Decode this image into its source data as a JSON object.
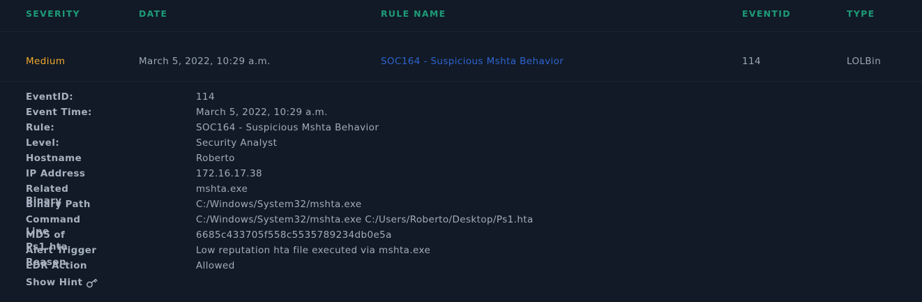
{
  "table": {
    "headers": {
      "severity": "SEVERITY",
      "date": "DATE",
      "rule_name": "RULE NAME",
      "eventid": "EVENTID",
      "type": "TYPE"
    },
    "row": {
      "severity": "Medium",
      "date": "March 5, 2022, 10:29 a.m.",
      "rule_name": "SOC164 - Suspicious Mshta Behavior",
      "eventid": "114",
      "type": "LOLBin"
    }
  },
  "details": [
    {
      "label": "EventID:",
      "value": "114"
    },
    {
      "label": "Event Time:",
      "value": "March 5, 2022, 10:29 a.m."
    },
    {
      "label": "Rule:",
      "value": "SOC164 - Suspicious Mshta Behavior"
    },
    {
      "label": "Level:",
      "value": "Security Analyst"
    },
    {
      "label": "Hostname",
      "value": "Roberto"
    },
    {
      "label": "IP Address",
      "value": "172.16.17.38"
    },
    {
      "label": "Related Binary",
      "value": "mshta.exe"
    },
    {
      "label": "Binary Path",
      "value": "C:/Windows/System32/mshta.exe"
    },
    {
      "label": "Command Line",
      "value": "C:/Windows/System32/mshta.exe C:/Users/Roberto/Desktop/Ps1.hta"
    },
    {
      "label": "MD5 of Ps1.hta",
      "value": "6685c433705f558c5535789234db0e5a"
    },
    {
      "label": "Alert Trigger Reason",
      "value": "Low reputation hta file executed via mshta.exe"
    },
    {
      "label": "EDR Action",
      "value": "Allowed"
    }
  ],
  "hint": {
    "label": "Show Hint",
    "icon": "key-icon"
  },
  "colors": {
    "background": "#111a26",
    "header_accent": "#1e9b78",
    "severity_medium": "#f2a72b",
    "link": "#2f63cf",
    "text": "#a3acb9"
  }
}
